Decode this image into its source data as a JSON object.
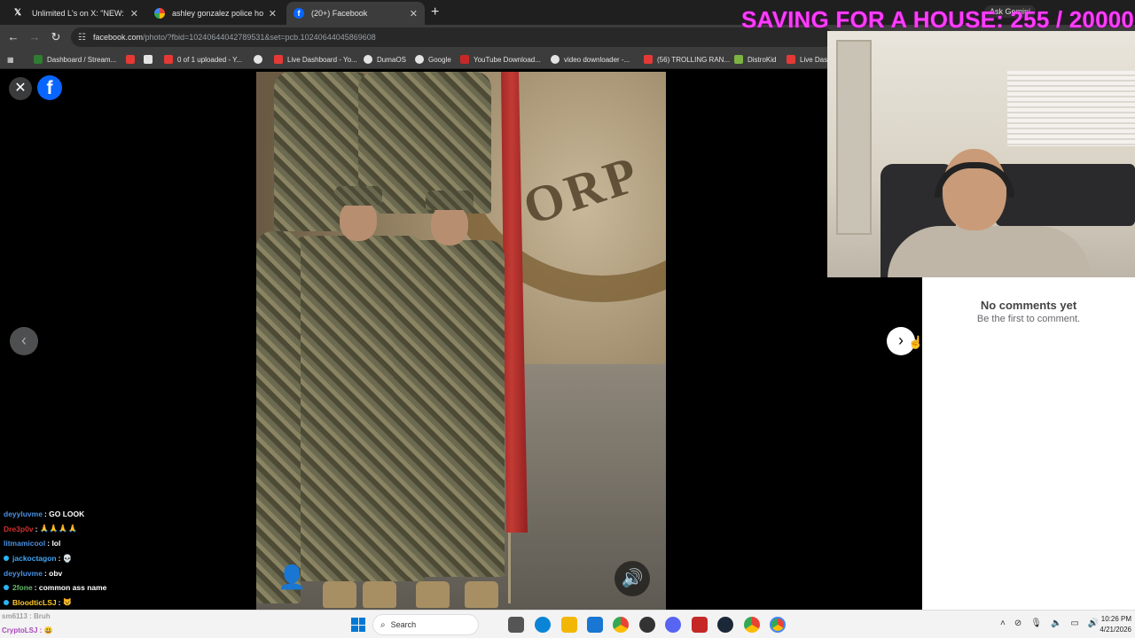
{
  "tabs": [
    {
      "title": "Unlimited L's on X: \"NEW: I",
      "icon": "x-icon"
    },
    {
      "title": "ashley gonzalez police houston",
      "icon": "google-icon"
    },
    {
      "title": "(20+) Facebook",
      "icon": "facebook-icon"
    }
  ],
  "address": {
    "host": "facebook.com",
    "path": "/photo/?fbid=10240644042789531&set=pcb.10240644045869608"
  },
  "bookmarks": [
    {
      "label": "Dashboard / Stream...",
      "color": "#2e7d32"
    },
    {
      "label": "",
      "color": "#e53935"
    },
    {
      "label": "",
      "color": "#e3e3e3"
    },
    {
      "label": "0 of 1 uploaded - Y...",
      "color": "#e53935"
    },
    {
      "label": "",
      "color": "#e3e3e3"
    },
    {
      "label": "Live Dashboard - Yo...",
      "color": "#e53935"
    },
    {
      "label": "DumaOS",
      "color": "#e3e3e3"
    },
    {
      "label": "Google",
      "color": "#e3e3e3"
    },
    {
      "label": "YouTube Download...",
      "color": "#c62828"
    },
    {
      "label": "video downloader -...",
      "color": "#e3e3e3"
    },
    {
      "label": "(56) TROLLING RAN...",
      "color": "#e53935"
    },
    {
      "label": "DistroKid",
      "color": "#7cb342"
    },
    {
      "label": "Live Dash",
      "color": "#e53935"
    }
  ],
  "goal_text": "SAVING FOR A HOUSE: 255 / 20000",
  "ask_gemini": "Ask Gemini",
  "comments": {
    "empty_title": "No comments yet",
    "empty_subtitle": "Be the first to comment."
  },
  "chat": [
    {
      "user": "deyyluvme",
      "message": "GO LOOK",
      "color": "#4a90e2",
      "badge": ""
    },
    {
      "user": "Dre3p0v",
      "message": "🙏🙏🙏🙏",
      "color": "#d32f2f",
      "badge": ""
    },
    {
      "user": "litmamicool",
      "message": "lol",
      "color": "#4a90e2",
      "badge": ""
    },
    {
      "user": "jackoctagon",
      "message": "💀",
      "color": "#42a5f5",
      "badge": "#29b6f6"
    },
    {
      "user": "deyyluvme",
      "message": "obv",
      "color": "#4a90e2",
      "badge": ""
    },
    {
      "user": "2fone",
      "message": "common ass name",
      "color": "#66bb6a",
      "badge": "#29b6f6"
    },
    {
      "user": "BloodticLSJ",
      "message": "😾",
      "color": "#ffca28",
      "badge": "#29b6f6"
    },
    {
      "user": "sm6113",
      "message": "Bruh",
      "color": "#9e9e9e",
      "badge": ""
    },
    {
      "user": "CryptoLSJ",
      "message": "😃",
      "color": "#ab47bc",
      "badge": "#29b6f6"
    }
  ],
  "taskbar": {
    "search_placeholder": "Search"
  },
  "clock": {
    "time": "10:26 PM",
    "date": "4/21/2026"
  }
}
